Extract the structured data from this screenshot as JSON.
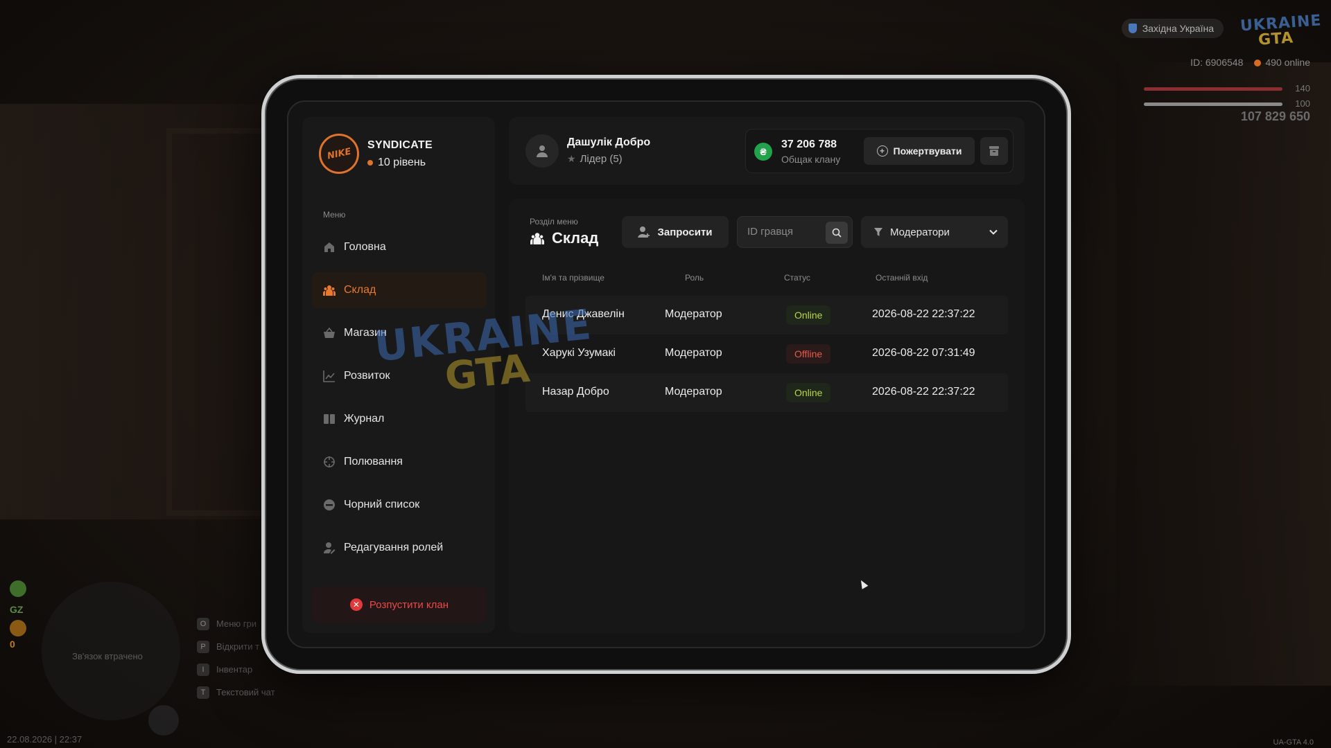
{
  "hud": {
    "region": "Західна Україна",
    "logo_top": "UKRAINE",
    "logo_bottom": "GTA",
    "player_id": "ID: 6906548",
    "online": "490 online",
    "health": "140",
    "armor": "100",
    "money": "107 829 650",
    "minimap_status": "Зв'язок втрачено",
    "gz_label": "GZ",
    "counter": "0",
    "hotkeys": [
      {
        "key": "O",
        "label": "Меню гри"
      },
      {
        "key": "P",
        "label": "Відкрити т"
      },
      {
        "key": "I",
        "label": "Інвентар"
      },
      {
        "key": "T",
        "label": "Текстовий чат"
      }
    ],
    "datetime": "22.08.2026 | 22:37",
    "version": "UA-GTA 4.0"
  },
  "clan": {
    "logo_text": "NIKE",
    "name": "SYNDICATE",
    "level": "10 рівень",
    "accent_color": "#e0732c"
  },
  "sidebar": {
    "caption": "Меню",
    "items": [
      {
        "label": "Головна",
        "icon": "home-icon",
        "active": false
      },
      {
        "label": "Склад",
        "icon": "members-icon",
        "active": true
      },
      {
        "label": "Магазин",
        "icon": "shop-basket-icon",
        "active": false
      },
      {
        "label": "Розвиток",
        "icon": "chart-icon",
        "active": false
      },
      {
        "label": "Журнал",
        "icon": "book-icon",
        "active": false
      },
      {
        "label": "Полювання",
        "icon": "crosshair-icon",
        "active": false
      },
      {
        "label": "Чорний список",
        "icon": "block-icon",
        "active": false
      },
      {
        "label": "Редагування ролей",
        "icon": "user-edit-icon",
        "active": false
      }
    ],
    "disband_label": "Розпустити клан"
  },
  "user": {
    "name": "Дашулік Добро",
    "role": "Лідер (5)"
  },
  "balance": {
    "currency_symbol": "₴",
    "amount": "37 206 788",
    "label": "Общак клану",
    "donate_label": "Пожертвувати"
  },
  "section": {
    "caption": "Розділ меню",
    "title": "Склад",
    "invite_label": "Запросити",
    "search_placeholder": "ID гравця",
    "filter_value": "Модератори"
  },
  "table": {
    "columns": [
      "Ім'я та прізвище",
      "Роль",
      "Статус",
      "Останній вхід"
    ],
    "rows": [
      {
        "name": "Денис Джавелін",
        "role": "Модератор",
        "status": "Online",
        "last_login": "2026-08-22 22:37:22"
      },
      {
        "name": "Харукі Узумакі",
        "role": "Модератор",
        "status": "Offline",
        "last_login": "2026-08-22 07:31:49"
      },
      {
        "name": "Назар Добро",
        "role": "Модератор",
        "status": "Online",
        "last_login": "2026-08-22 22:37:22"
      }
    ]
  },
  "watermark": {
    "line1": "UKRAINE",
    "line2": "GTA"
  },
  "colors": {
    "online": "#b9d84a",
    "offline": "#e85a4a",
    "danger": "#e23a3a",
    "coin": "#22a24a"
  }
}
